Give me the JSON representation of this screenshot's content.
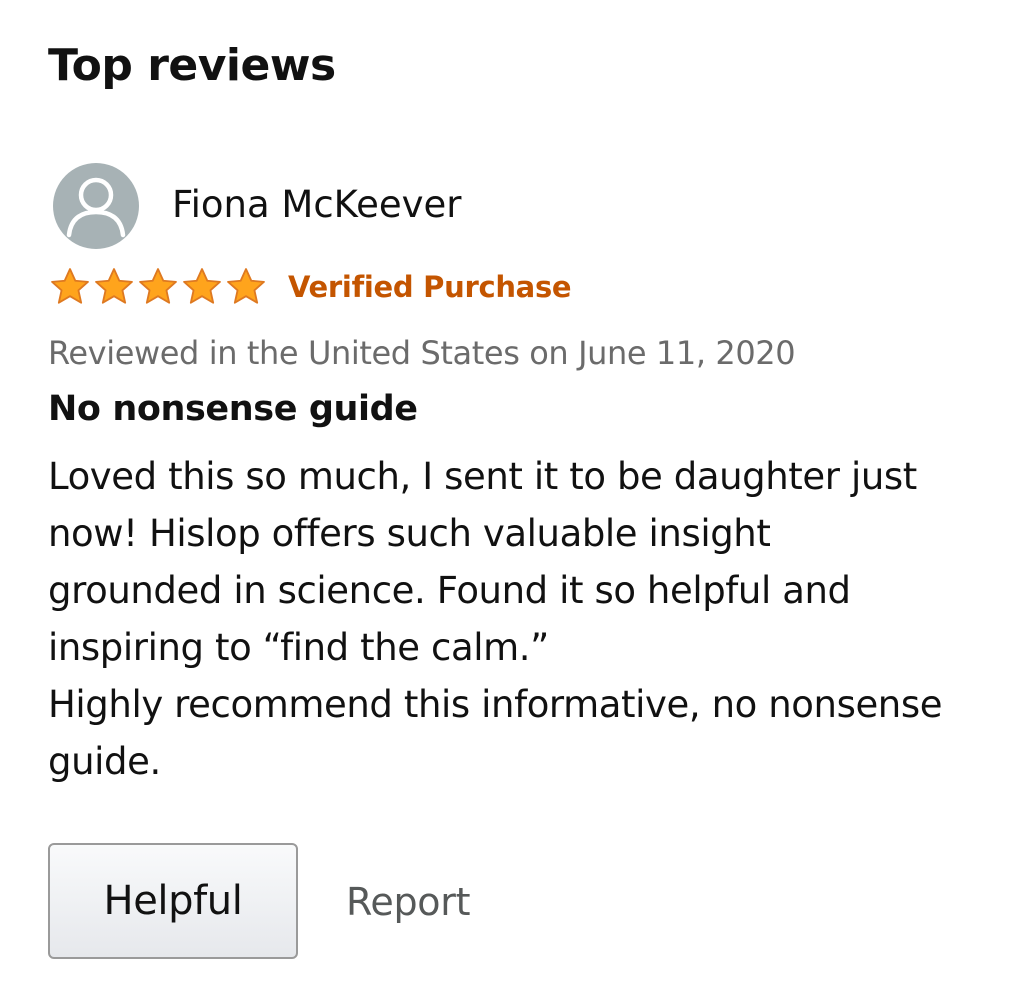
{
  "section": {
    "title": "Top reviews"
  },
  "review": {
    "reviewer_name": "Fiona McKeever",
    "avatar_icon": "user-silhouette-icon",
    "rating": 5,
    "rating_max": 5,
    "star_icon": "star-icon",
    "verified_label": "Verified Purchase",
    "date_line": "Reviewed in the United States on June 11, 2020",
    "title": "No nonsense guide",
    "body_lines": [
      "Loved this so much, I sent it to be daughter just",
      "now! Hislop offers such valuable insight",
      "grounded in science. Found it so helpful and",
      "inspiring to “find the calm.”",
      "Highly recommend this informative, no nonsense",
      "guide."
    ]
  },
  "actions": {
    "helpful_label": "Helpful",
    "report_label": "Report"
  },
  "colors": {
    "verified": "#c45500",
    "star_fill": "#ffa41c",
    "star_stroke": "#de7921",
    "avatar_bg": "#a7b2b5",
    "muted_text": "#6b6b6b"
  }
}
